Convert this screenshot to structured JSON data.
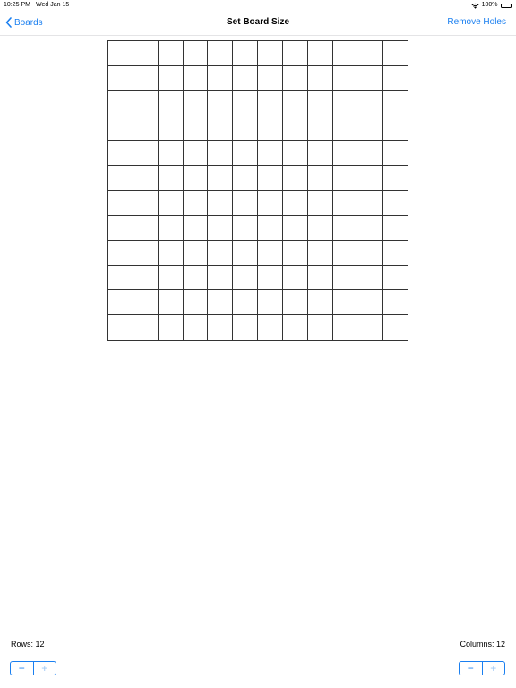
{
  "status_bar": {
    "time": "10:25 PM",
    "date": "Wed Jan 15",
    "battery": "100%"
  },
  "nav": {
    "back_label": "Boards",
    "title": "Set Board Size",
    "right_action": "Remove Holes"
  },
  "board": {
    "rows": 12,
    "columns": 12
  },
  "controls": {
    "rows_label": "Rows: 12",
    "columns_label": "Columns: 12",
    "minus_symbol": "−",
    "plus_symbol": "+"
  },
  "colors": {
    "accent": "#1a7ff0",
    "grid_line": "#333333"
  }
}
